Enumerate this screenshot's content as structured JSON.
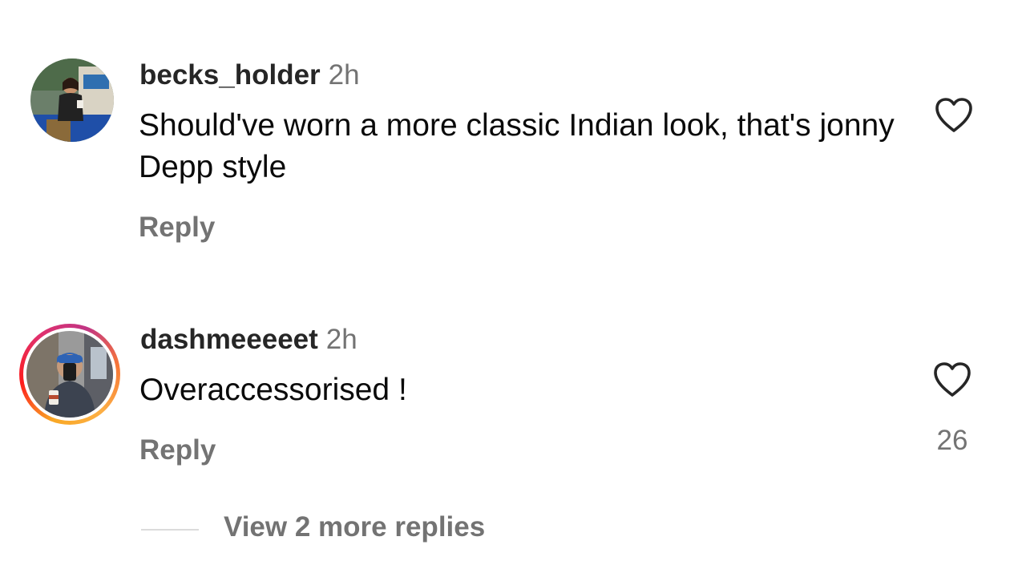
{
  "comments": [
    {
      "username": "becks_holder",
      "time": "2h",
      "text": "Should've worn a more classic Indian look, that's jonny Depp style",
      "reply_label": "Reply",
      "like_count": ""
    },
    {
      "username": "dashmeeeeet",
      "time": "2h",
      "text": "Overaccessorised !",
      "reply_label": "Reply",
      "like_count": "26"
    }
  ],
  "view_replies_label": "View 2 more replies",
  "icons": {
    "like": "heart-outline-icon"
  },
  "colors": {
    "username": "#262626",
    "secondary": "#737373",
    "story_ring_start": "#f9a825",
    "story_ring_end": "#e1306c"
  }
}
